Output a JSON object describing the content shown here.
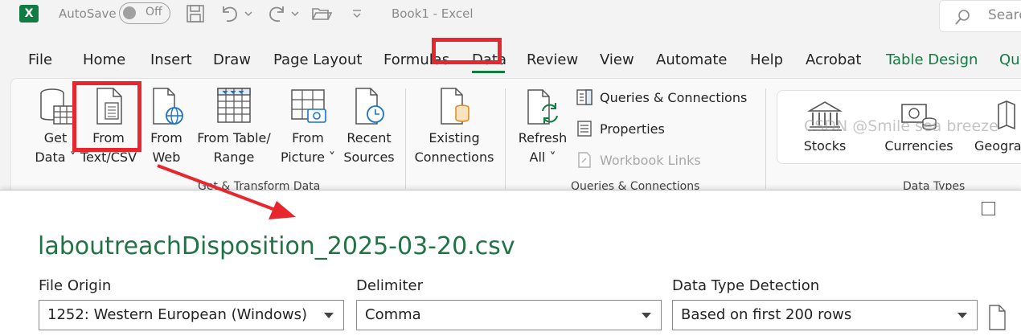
{
  "titlebar": {
    "logo_letter": "X",
    "autosave_label": "AutoSave",
    "autosave_state": "Off",
    "doc_title": "Book1  -  Excel",
    "search_placeholder": "Search"
  },
  "tabs": [
    {
      "label": "File"
    },
    {
      "label": "Home"
    },
    {
      "label": "Insert"
    },
    {
      "label": "Draw"
    },
    {
      "label": "Page Layout"
    },
    {
      "label": "Formulas"
    },
    {
      "label": "Data",
      "selected": true
    },
    {
      "label": "Review"
    },
    {
      "label": "View"
    },
    {
      "label": "Automate"
    },
    {
      "label": "Help"
    },
    {
      "label": "Acrobat"
    },
    {
      "label": "Table Design",
      "contextual": true
    },
    {
      "label": "Qu",
      "contextual": true
    }
  ],
  "ribbon": {
    "get_transform": {
      "get_data": [
        "Get",
        "Data ˅"
      ],
      "from_text_csv": [
        "From",
        "Text/CSV"
      ],
      "from_web": [
        "From",
        "Web"
      ],
      "from_table_range": [
        "From Table/",
        "Range"
      ],
      "from_picture": [
        "From",
        "Picture ˅"
      ],
      "recent_sources": [
        "Recent",
        "Sources"
      ],
      "existing_connections": [
        "Existing",
        "Connections"
      ],
      "group_label": "Get & Transform Data"
    },
    "queries": {
      "refresh_all": [
        "Refresh",
        "All ˅"
      ],
      "queries_connections": "Queries & Connections",
      "properties": "Properties",
      "workbook_links": "Workbook Links",
      "group_label": "Queries & Connections"
    },
    "data_types": {
      "stocks": "Stocks",
      "currencies": "Currencies",
      "geography": "Geogra",
      "group_label": "Data Types"
    }
  },
  "dialog": {
    "title": "laboutreachDisposition_2025-03-20.csv",
    "file_origin": {
      "label": "File Origin",
      "value": "1252: Western European (Windows)"
    },
    "delimiter": {
      "label": "Delimiter",
      "value": "Comma"
    },
    "detection": {
      "label": "Data Type Detection",
      "value": "Based on first 200 rows"
    }
  },
  "watermark": "CSDN @Smile sea breeze",
  "colors": {
    "accent": "#107c41",
    "annotation": "#e8262d",
    "title_green": "#217346"
  }
}
